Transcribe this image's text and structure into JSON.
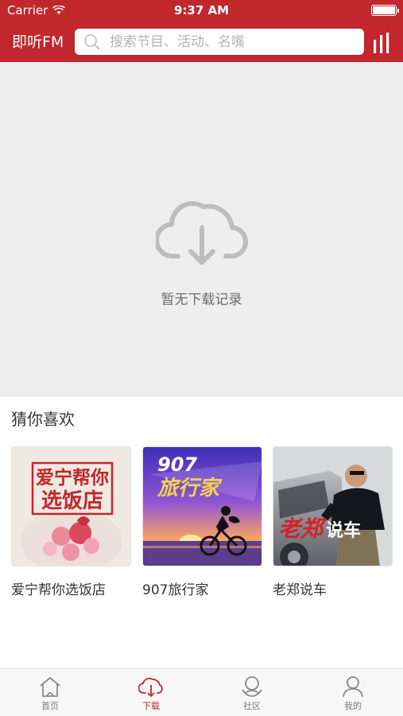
{
  "status_bar": {
    "carrier": "Carrier",
    "time": "9:37 AM"
  },
  "header": {
    "brand": "即听FM",
    "search_placeholder": "搜索节目、活动、名嘴",
    "accent_color": "#c1272d"
  },
  "empty_state": {
    "icon": "cloud-download-icon",
    "text": "暂无下载记录"
  },
  "recommend": {
    "title": "猜你喜欢",
    "items": [
      {
        "label": "爱宁帮你选饭店",
        "cover_text": "爱宁帮你选饭店"
      },
      {
        "label": "907旅行家",
        "cover_text_top": "907",
        "cover_text_bottom": "旅行家"
      },
      {
        "label": "老郑说车",
        "cover_text_a": "老郑",
        "cover_text_b": "说车"
      }
    ]
  },
  "tabs": [
    {
      "label": "首页",
      "icon": "home-icon",
      "active": false
    },
    {
      "label": "下载",
      "icon": "cloud-download-icon",
      "active": true
    },
    {
      "label": "社区",
      "icon": "community-icon",
      "active": false
    },
    {
      "label": "我的",
      "icon": "user-icon",
      "active": false
    }
  ]
}
